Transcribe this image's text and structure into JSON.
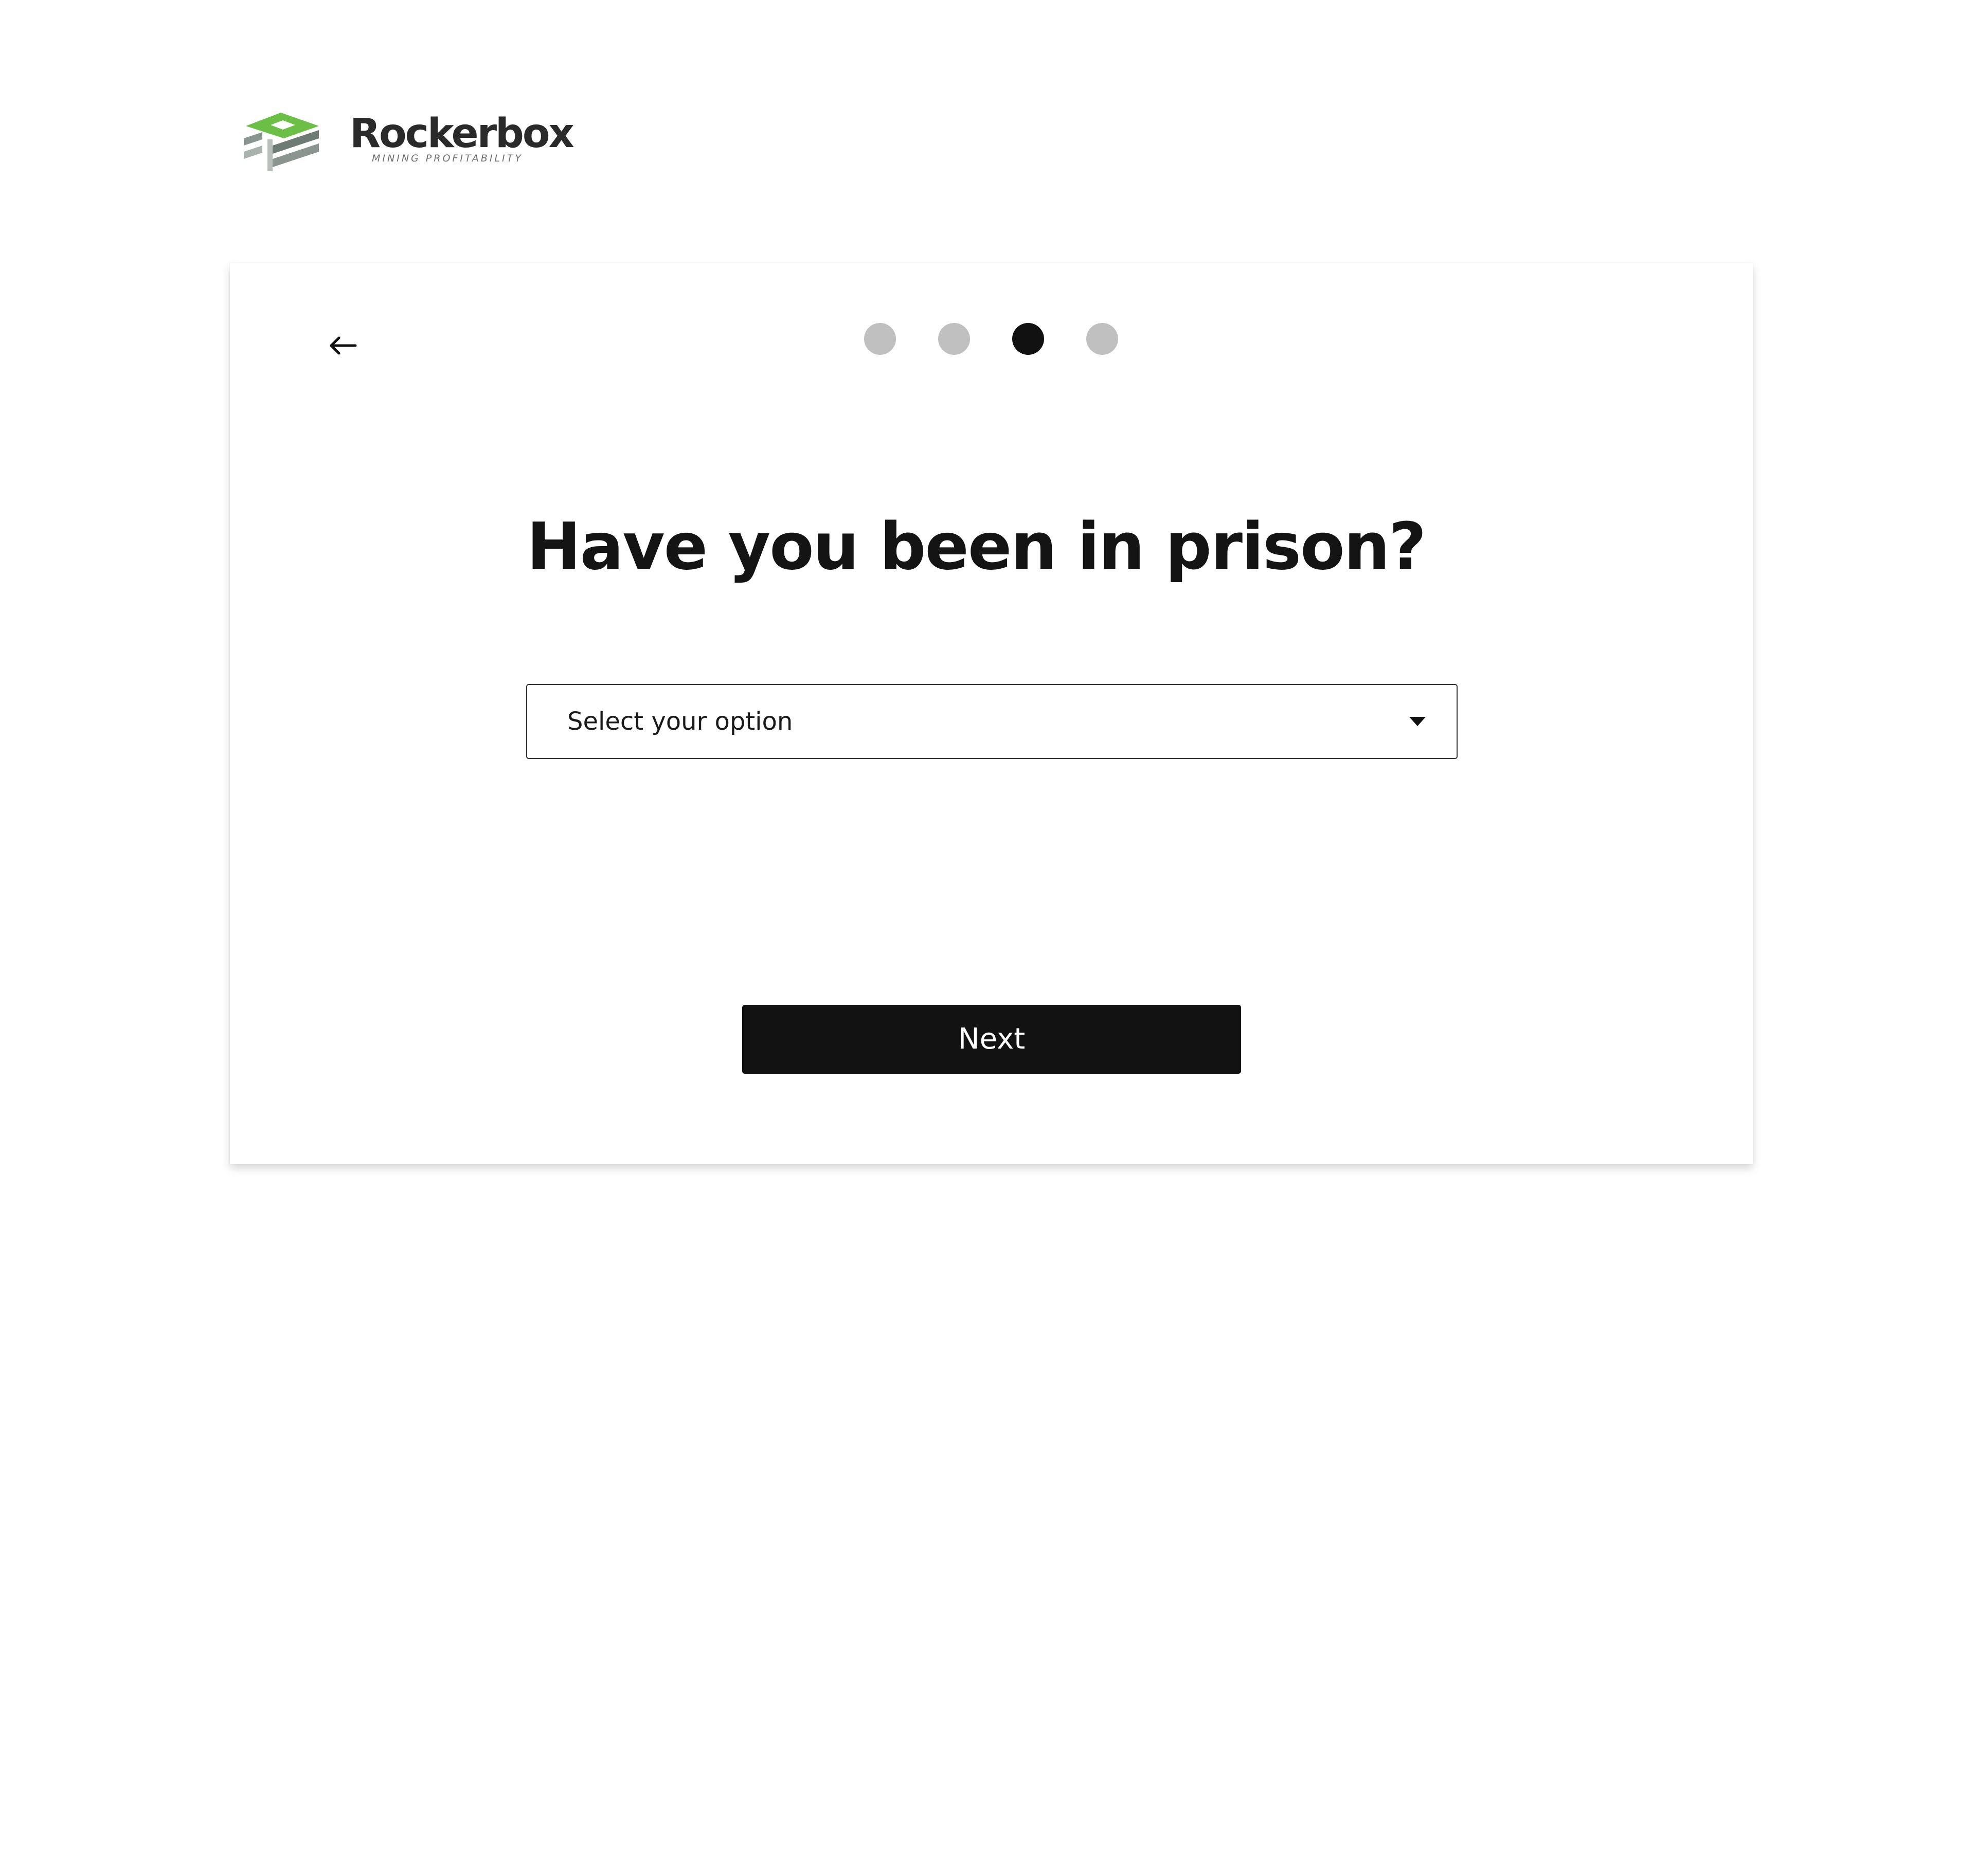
{
  "brand": {
    "name": "Rockerbox",
    "tagline": "MINING PROFITABILITY",
    "colors": {
      "green": "#6cbf45",
      "gray": "#8a9590",
      "dark": "#2a2a2a"
    }
  },
  "card": {
    "back_icon": "arrow-left-icon",
    "steps": {
      "total": 4,
      "current": 3,
      "active_color": "#111111",
      "inactive_color": "#c0c0c0"
    },
    "question": "Have you been in prison?",
    "select": {
      "placeholder": "Select your option",
      "icon": "caret-down-icon"
    },
    "next_label": "Next"
  }
}
